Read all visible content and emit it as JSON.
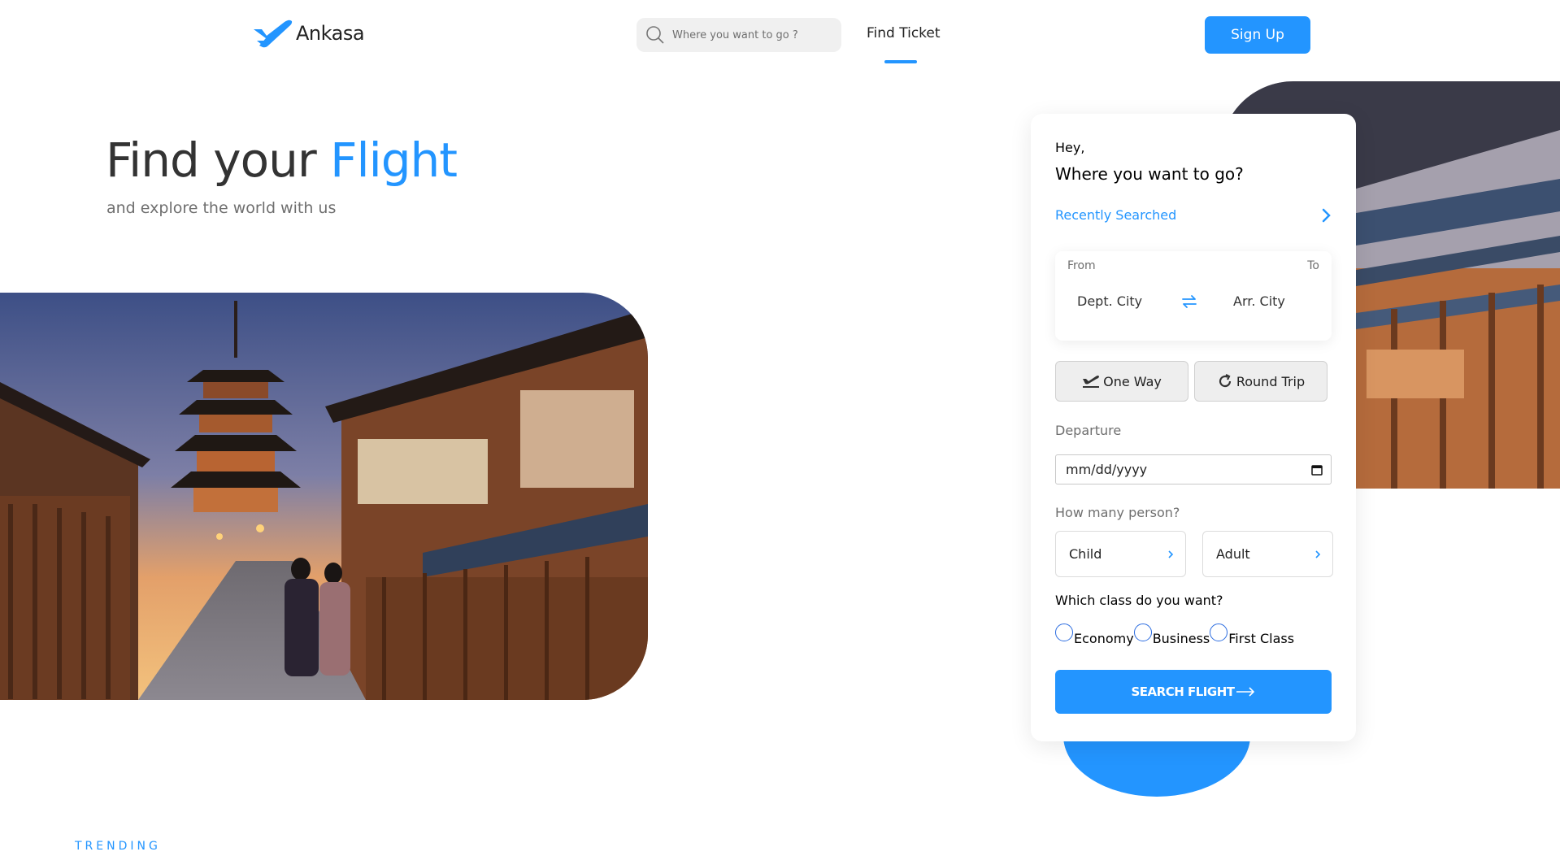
{
  "nav": {
    "brand": "Ankasa",
    "search_placeholder": "Where you want to go ?",
    "find_ticket": "Find Ticket",
    "sign_up": "Sign Up"
  },
  "hero": {
    "title_prefix": "Find your ",
    "title_accent": "Flight",
    "subtitle": "and explore the world with us"
  },
  "search_card": {
    "greeting": "Hey,",
    "question": "Where you want to go?",
    "recently_searched": "Recently Searched",
    "from_label": "From",
    "to_label": "To",
    "departure_city": "Dept. City",
    "arrival_city": "Arr. City",
    "one_way": "One Way",
    "round_trip": "Round Trip",
    "departure_label": "Departure",
    "date_placeholder": "mm/dd/yyyy",
    "persons_label": "How many person?",
    "child": "Child",
    "adult": "Adult",
    "class_question": "Which class do you want?",
    "classes": [
      "Economy",
      "Business",
      "First Class"
    ],
    "search_button": "SEARCH FLIGHT"
  },
  "section": {
    "trending": "TRENDING"
  },
  "colors": {
    "accent": "#2395ff",
    "text": "#333333",
    "muted": "#6f6f6f"
  }
}
